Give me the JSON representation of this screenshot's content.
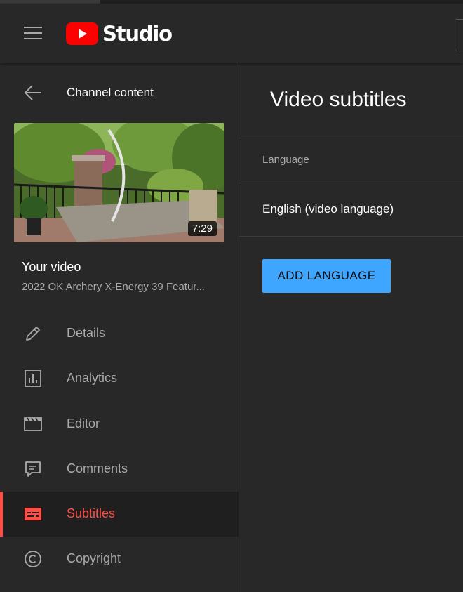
{
  "header": {
    "logo_text": "Studio",
    "brand_color": "#ff0000"
  },
  "sidebar": {
    "back_label": "Channel content",
    "thumbnail": {
      "duration": "7:29"
    },
    "your_video_label": "Your video",
    "video_title": "2022 OK Archery X-Energy 39 Featur...",
    "nav_items": [
      {
        "label": "Details",
        "icon": "pencil-icon"
      },
      {
        "label": "Analytics",
        "icon": "analytics-icon"
      },
      {
        "label": "Editor",
        "icon": "clapperboard-icon"
      },
      {
        "label": "Comments",
        "icon": "comment-icon"
      },
      {
        "label": "Subtitles",
        "icon": "subtitles-icon",
        "active": true
      },
      {
        "label": "Copyright",
        "icon": "copyright-icon"
      }
    ],
    "active_color": "#ff4e45"
  },
  "main": {
    "title": "Video subtitles",
    "column_header": "Language",
    "languages": [
      {
        "name": "English (video language)"
      }
    ],
    "add_button_label": "ADD LANGUAGE",
    "accent_color": "#3ea6ff"
  }
}
